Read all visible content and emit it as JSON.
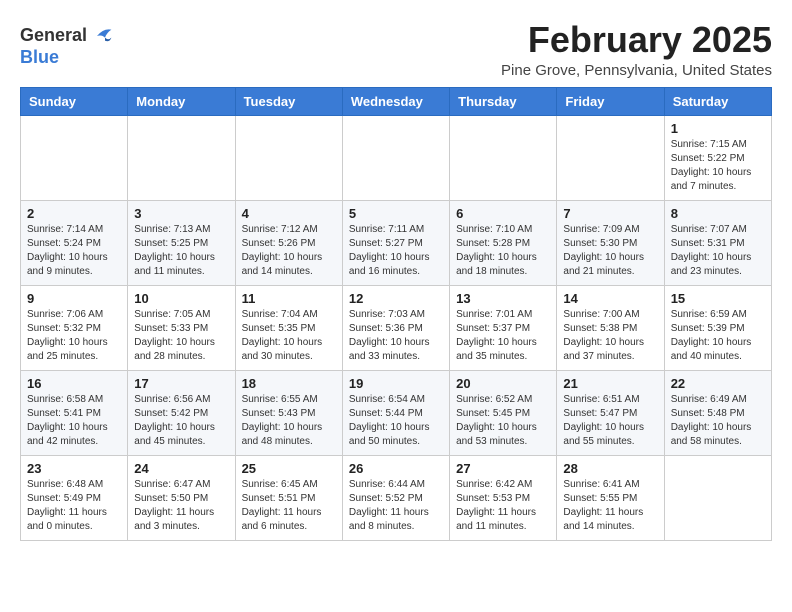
{
  "header": {
    "logo_general": "General",
    "logo_blue": "Blue",
    "month_title": "February 2025",
    "location": "Pine Grove, Pennsylvania, United States"
  },
  "days_of_week": [
    "Sunday",
    "Monday",
    "Tuesday",
    "Wednesday",
    "Thursday",
    "Friday",
    "Saturday"
  ],
  "weeks": [
    [
      {
        "day": "",
        "info": ""
      },
      {
        "day": "",
        "info": ""
      },
      {
        "day": "",
        "info": ""
      },
      {
        "day": "",
        "info": ""
      },
      {
        "day": "",
        "info": ""
      },
      {
        "day": "",
        "info": ""
      },
      {
        "day": "1",
        "info": "Sunrise: 7:15 AM\nSunset: 5:22 PM\nDaylight: 10 hours\nand 7 minutes."
      }
    ],
    [
      {
        "day": "2",
        "info": "Sunrise: 7:14 AM\nSunset: 5:24 PM\nDaylight: 10 hours\nand 9 minutes."
      },
      {
        "day": "3",
        "info": "Sunrise: 7:13 AM\nSunset: 5:25 PM\nDaylight: 10 hours\nand 11 minutes."
      },
      {
        "day": "4",
        "info": "Sunrise: 7:12 AM\nSunset: 5:26 PM\nDaylight: 10 hours\nand 14 minutes."
      },
      {
        "day": "5",
        "info": "Sunrise: 7:11 AM\nSunset: 5:27 PM\nDaylight: 10 hours\nand 16 minutes."
      },
      {
        "day": "6",
        "info": "Sunrise: 7:10 AM\nSunset: 5:28 PM\nDaylight: 10 hours\nand 18 minutes."
      },
      {
        "day": "7",
        "info": "Sunrise: 7:09 AM\nSunset: 5:30 PM\nDaylight: 10 hours\nand 21 minutes."
      },
      {
        "day": "8",
        "info": "Sunrise: 7:07 AM\nSunset: 5:31 PM\nDaylight: 10 hours\nand 23 minutes."
      }
    ],
    [
      {
        "day": "9",
        "info": "Sunrise: 7:06 AM\nSunset: 5:32 PM\nDaylight: 10 hours\nand 25 minutes."
      },
      {
        "day": "10",
        "info": "Sunrise: 7:05 AM\nSunset: 5:33 PM\nDaylight: 10 hours\nand 28 minutes."
      },
      {
        "day": "11",
        "info": "Sunrise: 7:04 AM\nSunset: 5:35 PM\nDaylight: 10 hours\nand 30 minutes."
      },
      {
        "day": "12",
        "info": "Sunrise: 7:03 AM\nSunset: 5:36 PM\nDaylight: 10 hours\nand 33 minutes."
      },
      {
        "day": "13",
        "info": "Sunrise: 7:01 AM\nSunset: 5:37 PM\nDaylight: 10 hours\nand 35 minutes."
      },
      {
        "day": "14",
        "info": "Sunrise: 7:00 AM\nSunset: 5:38 PM\nDaylight: 10 hours\nand 37 minutes."
      },
      {
        "day": "15",
        "info": "Sunrise: 6:59 AM\nSunset: 5:39 PM\nDaylight: 10 hours\nand 40 minutes."
      }
    ],
    [
      {
        "day": "16",
        "info": "Sunrise: 6:58 AM\nSunset: 5:41 PM\nDaylight: 10 hours\nand 42 minutes."
      },
      {
        "day": "17",
        "info": "Sunrise: 6:56 AM\nSunset: 5:42 PM\nDaylight: 10 hours\nand 45 minutes."
      },
      {
        "day": "18",
        "info": "Sunrise: 6:55 AM\nSunset: 5:43 PM\nDaylight: 10 hours\nand 48 minutes."
      },
      {
        "day": "19",
        "info": "Sunrise: 6:54 AM\nSunset: 5:44 PM\nDaylight: 10 hours\nand 50 minutes."
      },
      {
        "day": "20",
        "info": "Sunrise: 6:52 AM\nSunset: 5:45 PM\nDaylight: 10 hours\nand 53 minutes."
      },
      {
        "day": "21",
        "info": "Sunrise: 6:51 AM\nSunset: 5:47 PM\nDaylight: 10 hours\nand 55 minutes."
      },
      {
        "day": "22",
        "info": "Sunrise: 6:49 AM\nSunset: 5:48 PM\nDaylight: 10 hours\nand 58 minutes."
      }
    ],
    [
      {
        "day": "23",
        "info": "Sunrise: 6:48 AM\nSunset: 5:49 PM\nDaylight: 11 hours\nand 0 minutes."
      },
      {
        "day": "24",
        "info": "Sunrise: 6:47 AM\nSunset: 5:50 PM\nDaylight: 11 hours\nand 3 minutes."
      },
      {
        "day": "25",
        "info": "Sunrise: 6:45 AM\nSunset: 5:51 PM\nDaylight: 11 hours\nand 6 minutes."
      },
      {
        "day": "26",
        "info": "Sunrise: 6:44 AM\nSunset: 5:52 PM\nDaylight: 11 hours\nand 8 minutes."
      },
      {
        "day": "27",
        "info": "Sunrise: 6:42 AM\nSunset: 5:53 PM\nDaylight: 11 hours\nand 11 minutes."
      },
      {
        "day": "28",
        "info": "Sunrise: 6:41 AM\nSunset: 5:55 PM\nDaylight: 11 hours\nand 14 minutes."
      },
      {
        "day": "",
        "info": ""
      }
    ]
  ]
}
